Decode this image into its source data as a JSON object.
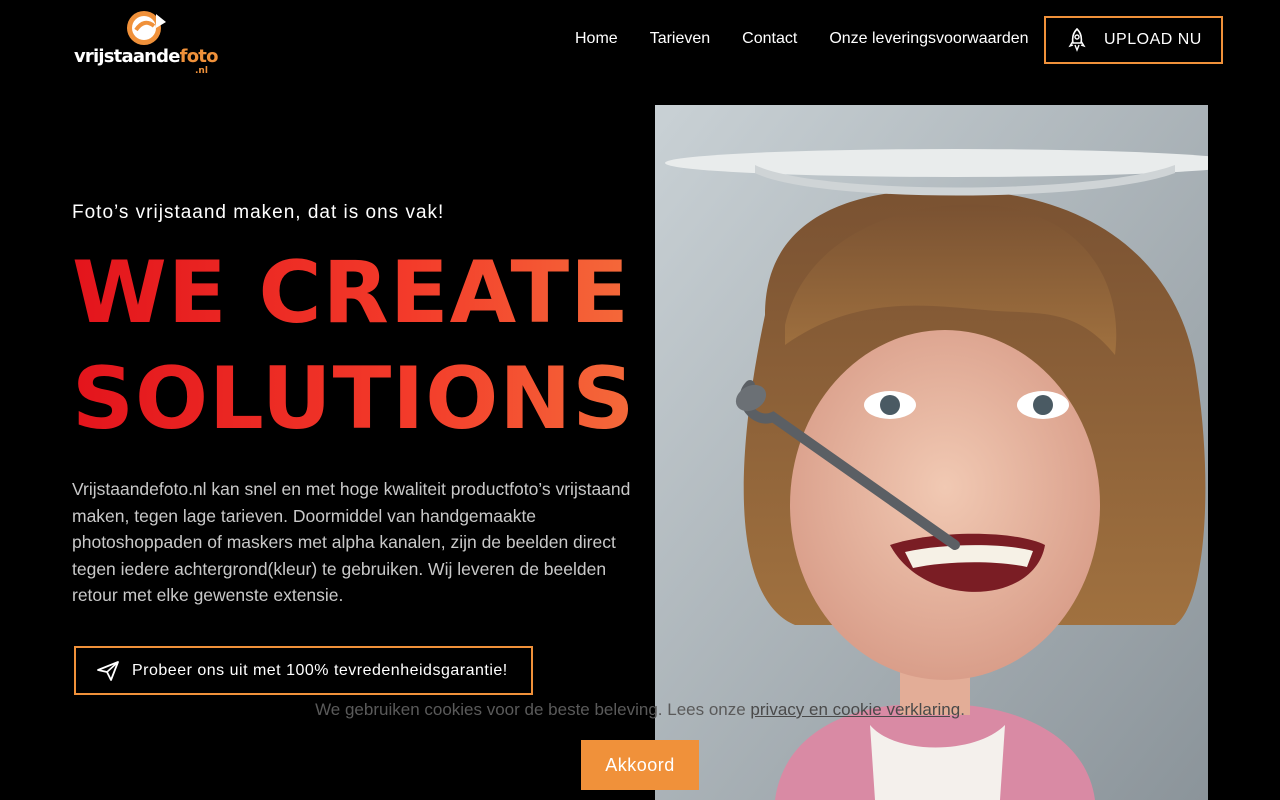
{
  "brand": {
    "name_white": "vrijstaande",
    "name_orange": "foto",
    "tld": ".nl"
  },
  "nav": [
    {
      "label": "Home"
    },
    {
      "label": "Tarieven"
    },
    {
      "label": "Contact"
    },
    {
      "label": "Onze leveringsvoorwaarden"
    }
  ],
  "upload_button": {
    "label": "UPLOAD NU",
    "icon": "rocket-icon"
  },
  "hero": {
    "tagline": "Foto’s vrijstaand maken, dat is ons vak!",
    "headline_line1": "WE CREATE",
    "headline_line2": "SOLUTIONS",
    "body": "Vrijstaandefoto.nl kan snel en met hoge kwaliteit productfoto’s vrijstaand maken, tegen lage tarieven. Doormiddel van handgemaakte photoshoppaden of maskers met alpha kanalen, zijn de beelden direct tegen iedere achtergrond(kleur) te gebruiken. Wij leveren de beelden retour met elke gewenste extensie.",
    "cta_label": "Probeer ons uit met 100% tevredenheidsgarantie!",
    "cta_icon": "paper-plane-icon"
  },
  "cookie": {
    "text_before": "We gebruiken cookies voor de beste beleving. Lees onze ",
    "link": "privacy en cookie verklaring",
    "text_after": ".",
    "accept_label": "Akkoord"
  },
  "colors": {
    "accent": "#f0913a",
    "headline_start": "#e3141c",
    "headline_end": "#f46a3a",
    "background": "#000000"
  }
}
